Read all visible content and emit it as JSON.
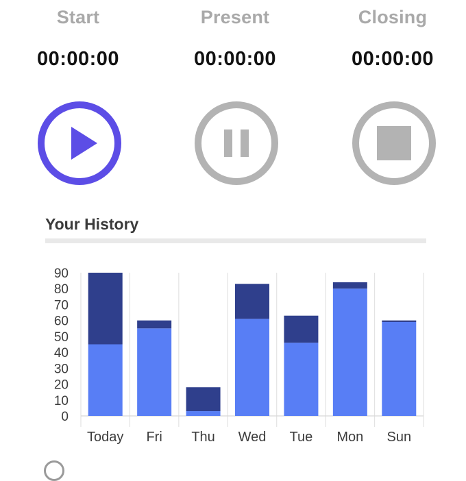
{
  "timers": [
    {
      "label": "Start",
      "time": "00:00:00"
    },
    {
      "label": "Present",
      "time": "00:00:00"
    },
    {
      "label": "Closing",
      "time": "00:00:00"
    }
  ],
  "controls": {
    "active_color": "#5c4de6",
    "inactive_color": "#b3b3b3",
    "play_icon": "play-icon",
    "pause_icon": "pause-icon",
    "stop_icon": "stop-icon"
  },
  "history": {
    "title": "Your History"
  },
  "chart_data": {
    "type": "bar",
    "stacked": true,
    "categories": [
      "Today",
      "Fri",
      "Thu",
      "Wed",
      "Tue",
      "Mon",
      "Sun"
    ],
    "series": [
      {
        "values": [
          45,
          55,
          3,
          61,
          46,
          80,
          59
        ],
        "color": "#587ef5"
      },
      {
        "values": [
          45,
          5,
          15,
          22,
          17,
          4,
          1
        ],
        "color": "#2f3f8c"
      }
    ],
    "yticks": [
      0,
      10,
      20,
      30,
      40,
      50,
      60,
      70,
      80,
      90
    ],
    "ylim": [
      0,
      90
    ],
    "grid": true,
    "title": "",
    "xlabel": "",
    "ylabel": ""
  }
}
